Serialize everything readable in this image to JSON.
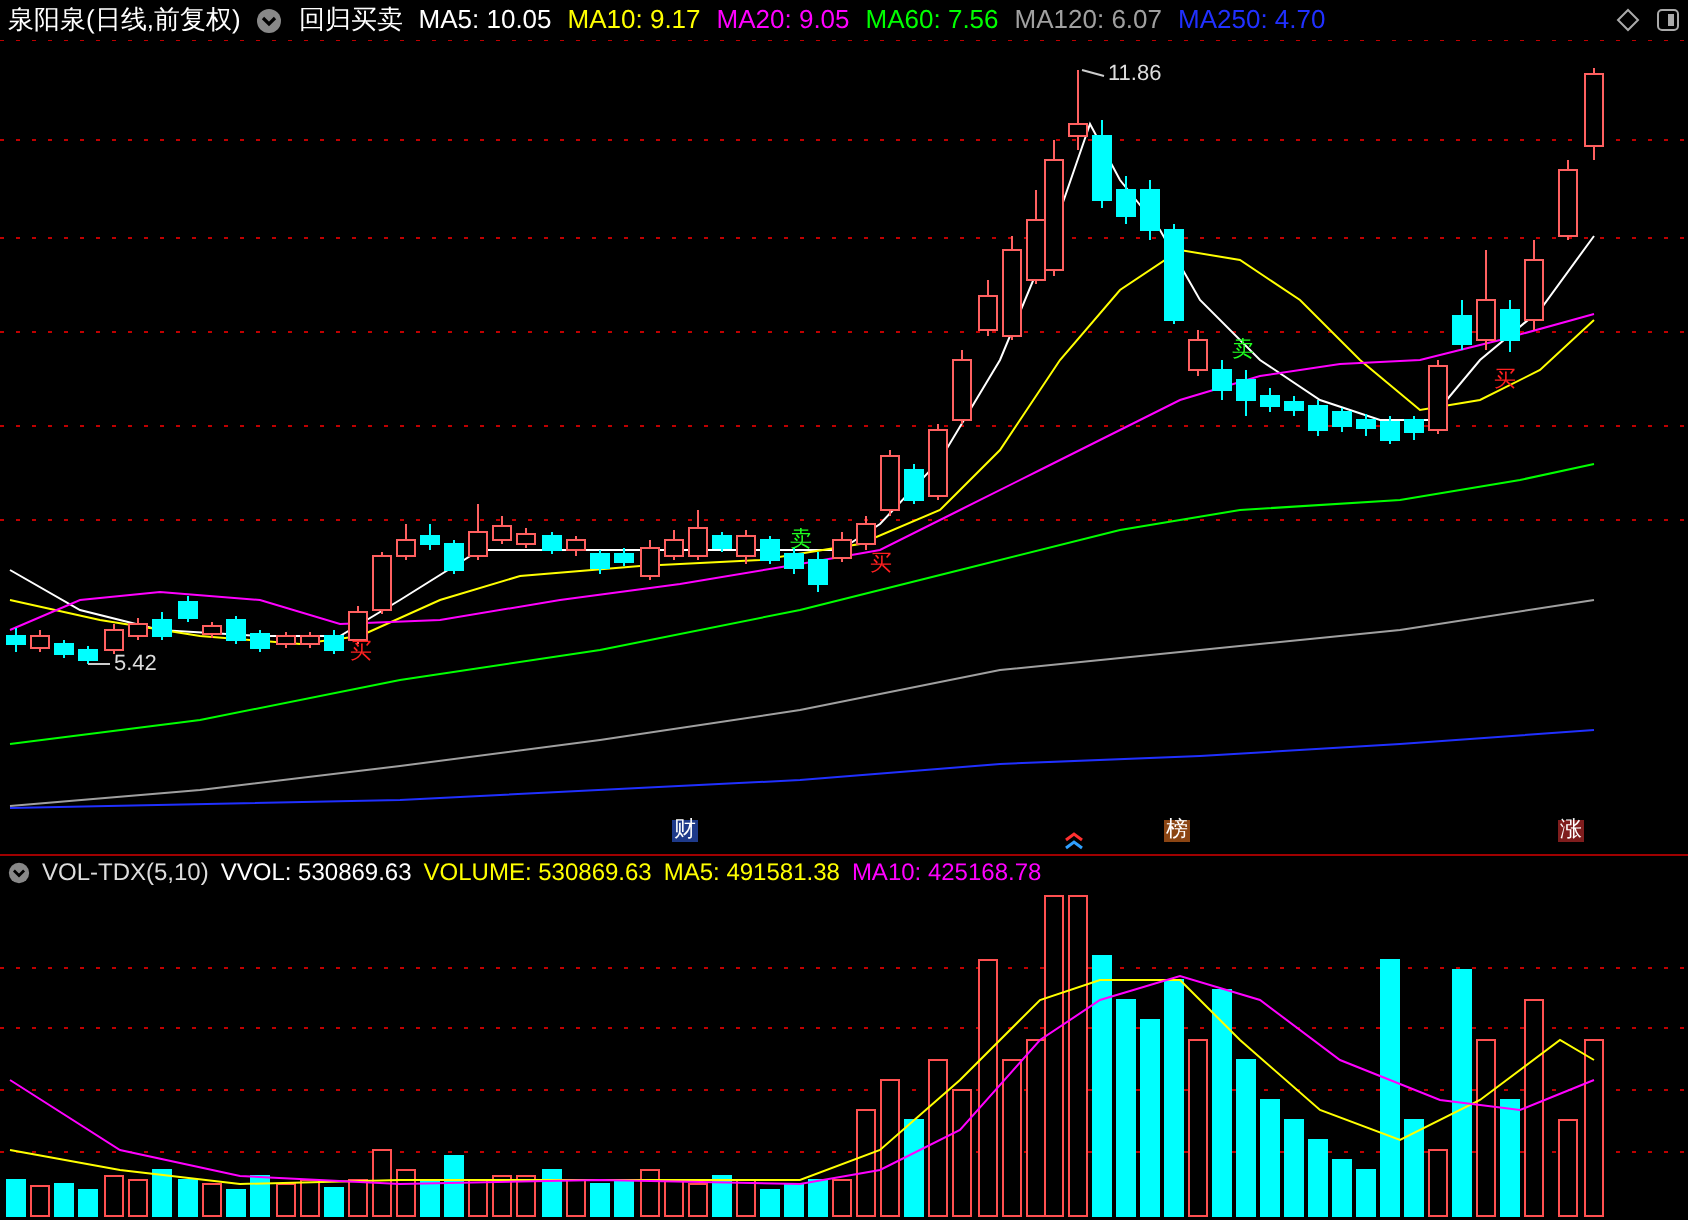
{
  "header": {
    "stock": "泉阳泉(日线,前复权)",
    "indicator": "回归买卖",
    "ma_readings": [
      {
        "text": "MA5: 10.05",
        "color": "#ffffff"
      },
      {
        "text": "MA10: 9.17",
        "color": "#ffff00"
      },
      {
        "text": "MA20: 9.05",
        "color": "#ff00ff"
      },
      {
        "text": "MA60: 7.56",
        "color": "#00ff00"
      },
      {
        "text": "MA120: 6.07",
        "color": "#a0a0a0"
      },
      {
        "text": "MA250: 4.70",
        "color": "#2030ff"
      }
    ]
  },
  "price_annotations": [
    {
      "text": "11.86"
    },
    {
      "text": "5.42"
    }
  ],
  "signals": [
    {
      "text": "买",
      "kind": "buy"
    },
    {
      "text": "卖",
      "kind": "sell"
    },
    {
      "text": "买",
      "kind": "buy"
    },
    {
      "text": "卖",
      "kind": "sell"
    },
    {
      "text": "买",
      "kind": "buy"
    }
  ],
  "event_markers": [
    {
      "text": "财",
      "color": "#1e3a8a"
    },
    {
      "text": "榜",
      "color": "#8b4513"
    },
    {
      "text": "涨",
      "color": "#7f1d1d"
    }
  ],
  "volume_header": {
    "indicator": "VOL-TDX(5,10)",
    "readings": [
      {
        "text": "VVOL: 530869.63",
        "color": "#ffffff"
      },
      {
        "text": "VOLUME: 530869.63",
        "color": "#ffff00"
      },
      {
        "text": "MA5: 491581.38",
        "color": "#ffff00"
      },
      {
        "text": "MA10: 425168.78",
        "color": "#ff00ff"
      }
    ]
  }
}
